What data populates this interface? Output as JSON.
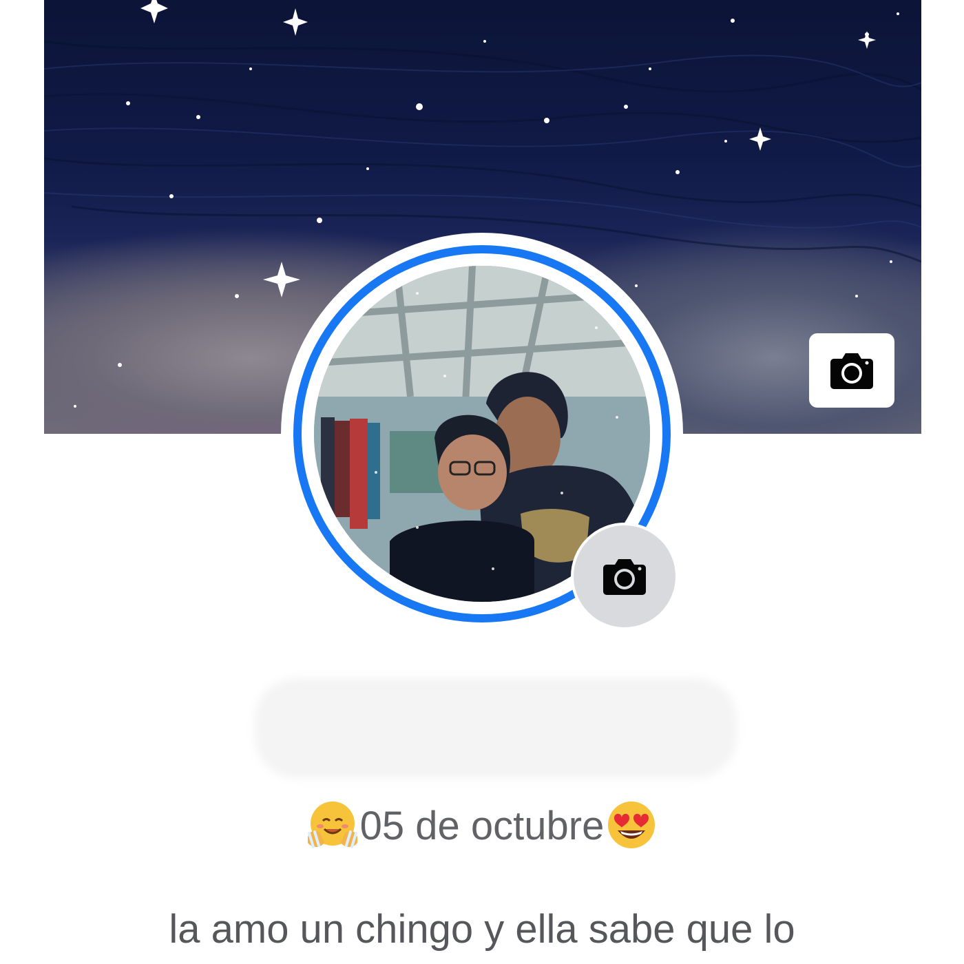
{
  "profile": {
    "cover_camera_icon": "camera-icon",
    "avatar_camera_icon": "camera-icon",
    "name": "",
    "date_text": "05 de octubre",
    "date_emoji_left": "hugging-face-emoji",
    "date_emoji_right": "heart-eyes-emoji",
    "bio_line_1": "la amo un chingo y ella sabe que lo"
  },
  "colors": {
    "accent": "#1877f2",
    "text_secondary": "#606266",
    "camera_button_bg": "#d9dadd"
  }
}
